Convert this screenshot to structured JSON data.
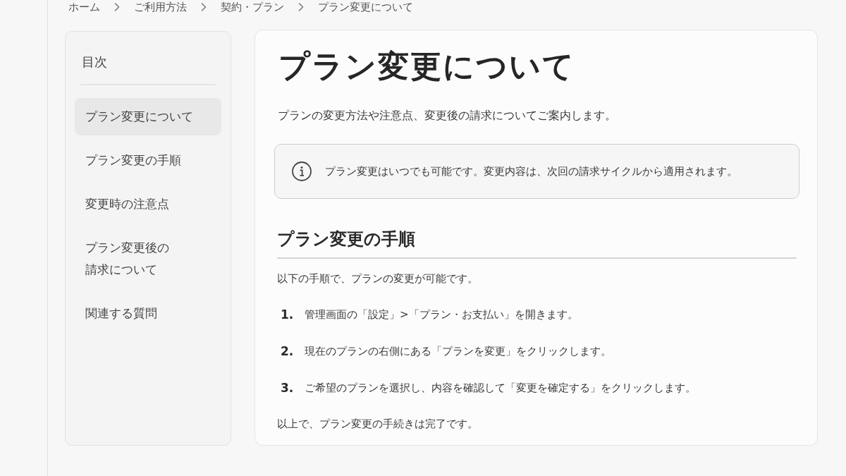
{
  "breadcrumb": [
    {
      "label": "ホーム"
    },
    {
      "label": "ご利用方法"
    },
    {
      "label": "契約・プラン"
    },
    {
      "label": "プラン変更について"
    }
  ],
  "toc": {
    "title": "目次",
    "items": [
      {
        "lines": [
          "プラン変更について"
        ],
        "selected": true
      },
      {
        "lines": [
          "プラン変更の手順"
        ],
        "selected": false
      },
      {
        "lines": [
          "変更時の注意点"
        ],
        "selected": false
      },
      {
        "lines": [
          "プラン変更後の",
          "請求について"
        ],
        "selected": false
      },
      {
        "lines": [
          "関連する質問"
        ],
        "selected": false
      }
    ]
  },
  "article": {
    "title": "プラン変更について",
    "lead": "プランの変更方法や注意点、変更後の請求についてご案内します。",
    "notice": {
      "text": "プラン変更はいつでも可能です。変更内容は、次回の請求サイクルから適用されます。"
    },
    "sections": [
      {
        "heading": "プラン変更の手順",
        "intro": "以下の手順で、プランの変更が可能です。",
        "steps": [
          {
            "number": "1.",
            "text": "管理画面の「設定」>「プラン・お支払い」を開きます。"
          },
          {
            "number": "2.",
            "text": "現在のプランの右側にある「プランを変更」をクリックします。"
          },
          {
            "number": "3.",
            "text": "ご希望のプランを選択し、内容を確認して「変更を確定する」をクリックします。"
          }
        ],
        "outro": "以上で、プラン変更の手続きは完了です。"
      }
    ]
  }
}
